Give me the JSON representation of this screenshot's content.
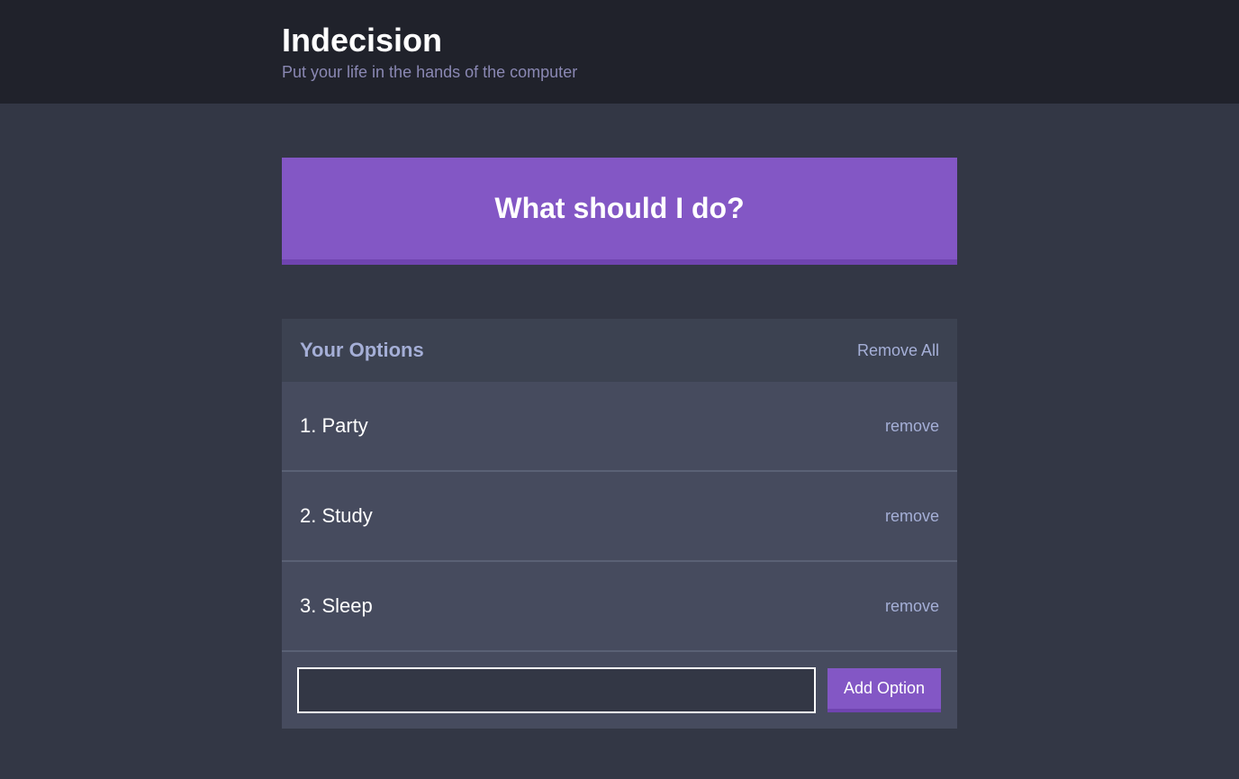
{
  "header": {
    "title": "Indecision",
    "subtitle": "Put your life in the hands of the computer"
  },
  "action": {
    "label": "What should I do?"
  },
  "options": {
    "title": "Your Options",
    "remove_all_label": "Remove All",
    "remove_label": "remove",
    "items": [
      {
        "text": "1. Party"
      },
      {
        "text": "2. Study"
      },
      {
        "text": "3. Sleep"
      }
    ]
  },
  "add_option": {
    "button_label": "Add Option"
  }
}
